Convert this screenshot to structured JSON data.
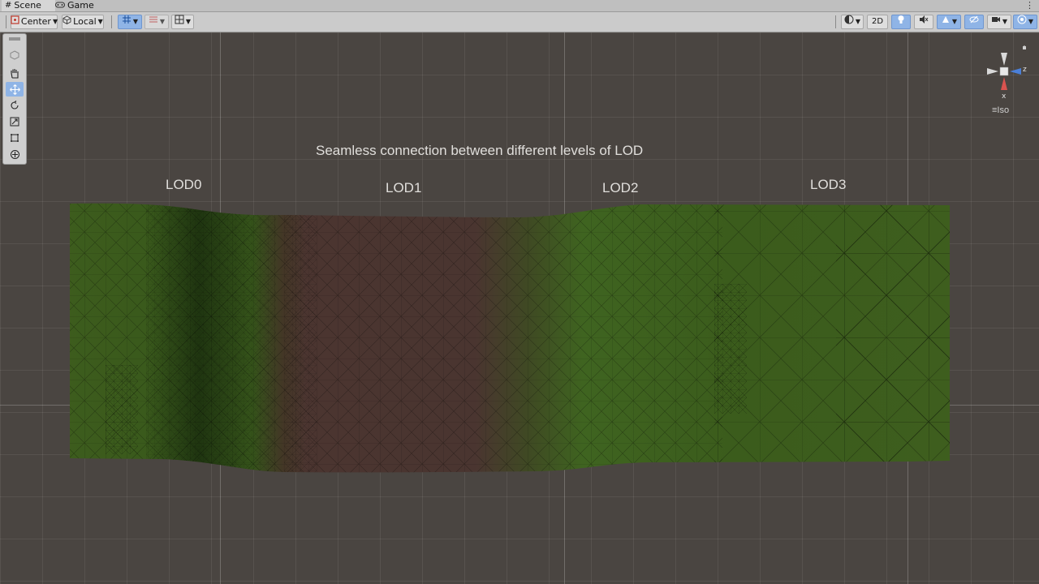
{
  "tabs": [
    {
      "label": "Scene",
      "icon": "hash-grid-icon"
    },
    {
      "label": "Game",
      "icon": "gamepad-icon"
    }
  ],
  "toolbar": {
    "pivot_label": "Center",
    "space_label": "Local",
    "mode_2d_label": "2D"
  },
  "scene": {
    "title": "Seamless connection between different levels of LOD",
    "lod_labels": [
      "LOD0",
      "LOD1",
      "LOD2",
      "LOD3"
    ]
  },
  "gizmo": {
    "axis_z": "z",
    "axis_x": "x",
    "projection_label": "Iso"
  },
  "colors": {
    "grass": "#3a5a1c",
    "dirt": "#4b3530",
    "grid_background": "#4a4541",
    "tool_active": "#8fb4e6",
    "axis_x": "#d9534f",
    "axis_z": "#4a7fd8"
  }
}
